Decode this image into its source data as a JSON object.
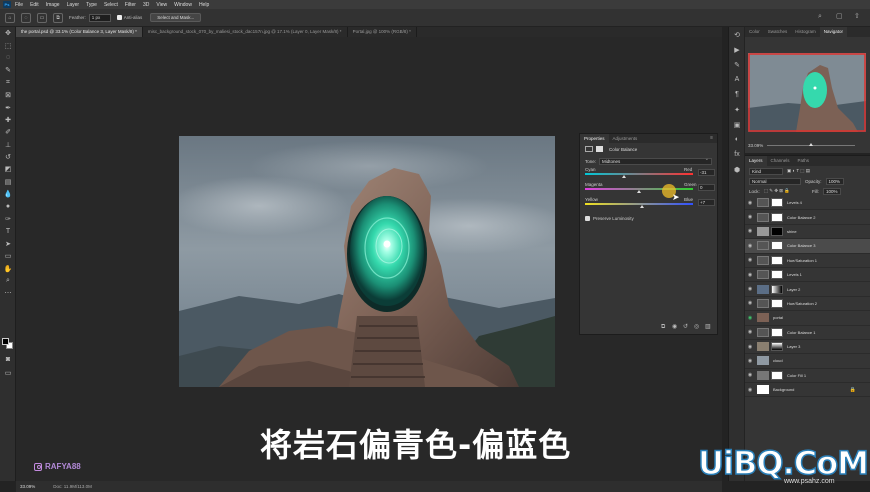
{
  "menubar": {
    "logo": "Ps",
    "items": [
      "File",
      "Edit",
      "Image",
      "Layer",
      "Type",
      "Select",
      "Filter",
      "3D",
      "View",
      "Window",
      "Help"
    ]
  },
  "options": {
    "feather_label": "Feather:",
    "feather_value": "1 px",
    "antialias_label": "Anti-alias",
    "select_mask_label": "Select and Mask..."
  },
  "tabs": [
    {
      "label": "the portal.psd @ 33.1% (Color Balance 3, Layer Mask/8) *"
    },
    {
      "label": "misc_background_stock_070_by_maliesi_stock_dac157n.jpg @ 17.1% (Layer 0, Layer Mask/8) *"
    },
    {
      "label": "Portal.jpg @ 100% (RGB/8) *"
    }
  ],
  "statusbar": {
    "zoom": "33.09%",
    "doc": "Doc: 11.9M/113.0M"
  },
  "properties": {
    "tabs": [
      "Properties",
      "Adjustments"
    ],
    "title": "Color Balance",
    "tone_label": "Tone:",
    "tone_value": "Midtones",
    "sliders": [
      {
        "left": "Cyan",
        "right": "Red",
        "value": "-31",
        "pos": 0.36
      },
      {
        "left": "Magenta",
        "right": "Green",
        "value": "0",
        "pos": 0.5
      },
      {
        "left": "Yellow",
        "right": "Blue",
        "value": "+7",
        "pos": 0.53
      }
    ],
    "preserve_label": "Preserve Luminosity"
  },
  "navigator": {
    "tabs": [
      "Color",
      "Swatches",
      "Histogram",
      "Navigator"
    ],
    "zoom": "33.09%"
  },
  "layers": {
    "tabs": [
      "Layers",
      "Channels",
      "Paths"
    ],
    "kind_label": "Kind",
    "blend_mode": "Normal",
    "opacity_label": "Opacity:",
    "opacity_value": "100%",
    "lock_label": "Lock:",
    "fill_label": "Fill:",
    "fill_value": "100%",
    "items": [
      {
        "name": "Levels 4"
      },
      {
        "name": "Color Balance 2"
      },
      {
        "name": "shine"
      },
      {
        "name": "Color Balance 3"
      },
      {
        "name": "Hue/Saturation 1"
      },
      {
        "name": "Levels 1"
      },
      {
        "name": "Layer 2"
      },
      {
        "name": "Hue/Saturation 2"
      },
      {
        "name": "portal"
      },
      {
        "name": "Color Balance 1"
      },
      {
        "name": "Layer 3"
      },
      {
        "name": "cloud"
      },
      {
        "name": "Color Fill 1"
      },
      {
        "name": "Background"
      }
    ]
  },
  "subtitle": "将岩石偏青色-偏蓝色",
  "watermark": "RAFYA88",
  "logo_text": "UiBQ.CoM",
  "logo_sub": "www.psahz.com",
  "colors": {
    "accent": "#31a8ff",
    "portal": "#3fe6b8"
  }
}
